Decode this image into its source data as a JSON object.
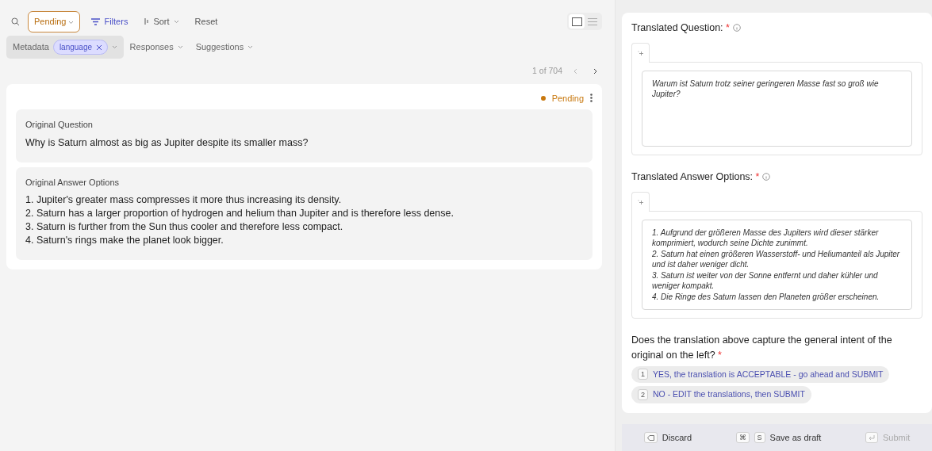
{
  "toolbar": {
    "status_filter": "Pending",
    "filters": "Filters",
    "sort": "Sort",
    "reset": "Reset",
    "views": [
      {
        "kind": "card",
        "selected": true
      },
      {
        "kind": "list",
        "selected": false
      }
    ]
  },
  "filter_bar": [
    {
      "label": "Metadata",
      "chip": "language",
      "selected": true
    },
    {
      "label": "Responses",
      "selected": false
    },
    {
      "label": "Suggestions",
      "selected": false
    }
  ],
  "pagination": {
    "text": "1 of 704"
  },
  "record": {
    "status": "Pending",
    "fields": [
      {
        "title": "Original Question",
        "lines": [
          "Why is Saturn almost as big as Jupiter despite its smaller mass?"
        ]
      },
      {
        "title": "Original Answer Options",
        "lines": [
          "1. Jupiter's greater mass compresses it more thus increasing its density.",
          "2. Saturn has a larger proportion of hydrogen and helium than Jupiter and is therefore less dense.",
          "3. Saturn is further from the Sun thus cooler and therefore less compact.",
          "4. Saturn's rings make the planet look bigger."
        ]
      }
    ]
  },
  "questions": [
    {
      "kind": "text",
      "title": "Translated Question:",
      "required_mark": "*",
      "lines": [
        "Warum ist Saturn trotz seiner geringeren Masse fast so groß wie Jupiter?"
      ]
    },
    {
      "kind": "text",
      "title": "Translated Answer Options:",
      "required_mark": "*",
      "lines": [
        "1. Aufgrund der größeren Masse des Jupiters wird dieser stärker komprimiert, wodurch seine Dichte zunimmt.",
        "2. Saturn hat einen größeren Wasserstoff- und Heliumanteil als Jupiter und ist daher weniger dicht.",
        "3. Saturn ist weiter von der Sonne entfernt und daher kühler und weniger kompakt.",
        "4. Die Ringe des Saturn lassen den Planeten größer erscheinen."
      ]
    },
    {
      "kind": "choice",
      "title": "Does the translation above capture the general intent of the original on the left?",
      "required_mark": "*",
      "options": [
        {
          "key": "1",
          "label": "YES, the translation is ACCEPTABLE - go ahead and SUBMIT",
          "selected": false
        },
        {
          "key": "2",
          "label": "NO - EDIT the translations, then SUBMIT",
          "selected": false
        }
      ]
    }
  ],
  "footer": [
    {
      "kind": "discard",
      "label": "Discard",
      "disabled": false
    },
    {
      "kind": "draft",
      "keys": [
        "⌘",
        "S"
      ],
      "label": "Save as draft",
      "disabled": false
    },
    {
      "kind": "submit",
      "label": "Submit",
      "disabled": true
    }
  ]
}
